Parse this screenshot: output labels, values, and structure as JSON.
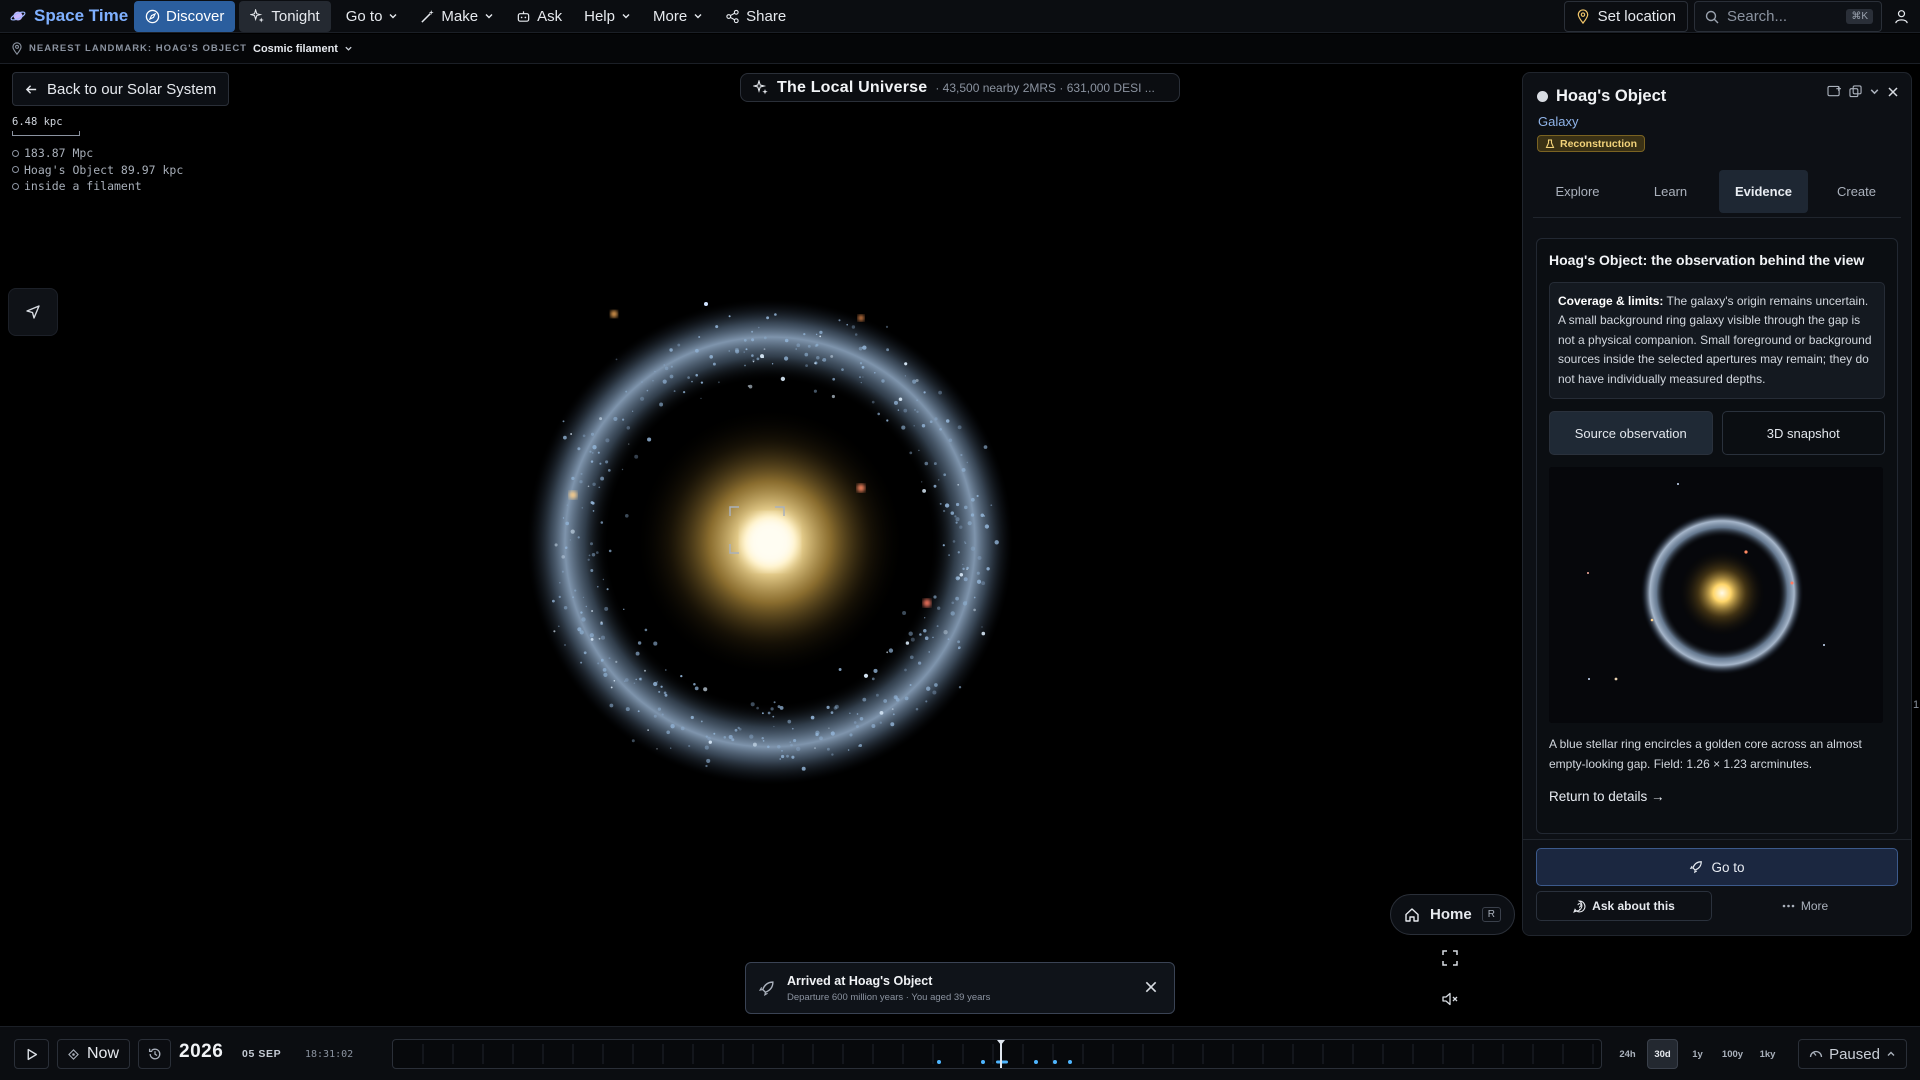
{
  "app": {
    "name": "Space Time"
  },
  "nav": {
    "items": [
      {
        "label": "Discover",
        "icon": "compass-icon"
      },
      {
        "label": "Tonight",
        "icon": "sparkles-icon"
      },
      {
        "label": "Go to",
        "icon": "chevron-down-icon"
      },
      {
        "label": "Make",
        "icon": "wand-icon"
      },
      {
        "label": "Ask",
        "icon": "robot-icon"
      },
      {
        "label": "Help",
        "icon": "chevron-down-icon"
      },
      {
        "label": "More",
        "icon": "chevron-down-icon"
      },
      {
        "label": "Share",
        "icon": "share-icon"
      }
    ],
    "set_location": "Set location",
    "search_placeholder": "Search...",
    "search_shortcut": "⌘K"
  },
  "landmark": {
    "label": "NEAREST LANDMARK: HOAG'S OBJECT",
    "value": "Cosmic filament"
  },
  "viewport": {
    "back_label": "Back to our Solar System",
    "scale_label": "6.48 kpc",
    "readouts": [
      "183.87 Mpc",
      "Hoag's Object 89.97 kpc",
      "inside a filament"
    ],
    "universe_title": "The Local Universe",
    "universe_sub": "· 43,500 nearby 2MRS · 631,000 DESI ..."
  },
  "panel": {
    "title": "Hoag's Object",
    "subtitle": "Galaxy",
    "badge": "Reconstruction",
    "tabs": [
      "Explore",
      "Learn",
      "Evidence",
      "Create"
    ],
    "active_tab": "Evidence",
    "card_title": "Hoag's Object: the observation behind the view",
    "coverage_label": "Coverage & limits:",
    "coverage_text": " The galaxy's origin remains uncertain. A small background ring galaxy visible through the gap is not a physical companion. Small foreground or background sources inside the selected apertures may remain; they do not have individually measured depths.",
    "switch": [
      "Source observation",
      "3D snapshot"
    ],
    "caption": "A blue stellar ring encircles a golden core across an almost empty-looking gap. Field: 1.26 × 1.23 arcminutes.",
    "return_link": "Return to details →",
    "goto_label": "Go to",
    "ask_label": "Ask about this",
    "more_label": "More"
  },
  "edge_mark": "1",
  "controls": {
    "home_label": "Home",
    "home_key": "R"
  },
  "toast": {
    "title": "Arrived at Hoag's Object",
    "subtitle": "Departure 600 million years · You aged 39 years"
  },
  "timeline": {
    "now_label": "Now",
    "year": "2026",
    "date": "05 SEP",
    "time": "18:31:02",
    "scales": [
      "24h",
      "30d",
      "1y",
      "100y",
      "1ky"
    ],
    "active_scale": "30d",
    "status": "Paused"
  },
  "colors": {
    "accent": "#2b5e9e",
    "brand": "#7fb0ff",
    "badge_gold": "#f2d27a",
    "ring_blue": "#9fc4e8",
    "core_gold": "#ffe9a8"
  }
}
